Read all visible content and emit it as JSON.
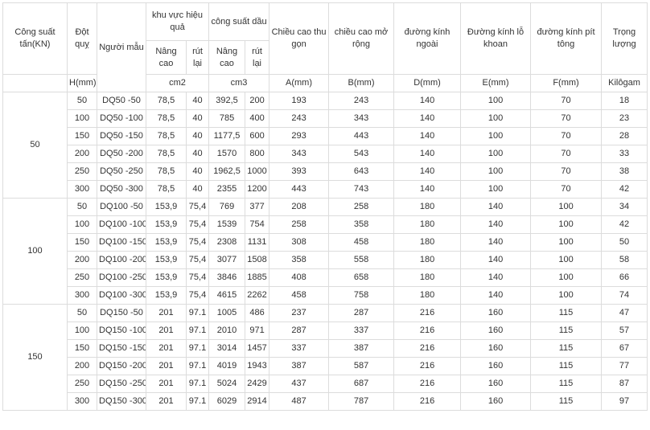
{
  "headers": {
    "capacity": "Công suất tấn(KN)",
    "stroke": "Đột quỵ",
    "model": "Người mẫu",
    "effective_area": "khu vực hiệu quả",
    "oil_capacity": "công suất dầu",
    "closed_height": "Chiều cao thu gọn",
    "extended_height": "chiều cao mở rộng",
    "outer_diameter": "đường kính ngoài",
    "bore_diameter": "Đường kính lỗ khoan",
    "piston_diameter": "đường kính pít tông",
    "weight": "Trọng lượng",
    "area_lift": "Nâng cao",
    "area_retract": "rút lại",
    "oil_lift": "Nâng cao",
    "oil_retract": "rút lại"
  },
  "units": {
    "stroke": "H(mm)",
    "area": "cm2",
    "oil": "cm3",
    "closed": "A(mm)",
    "extended": "B(mm)",
    "outer": "D(mm)",
    "bore": "E(mm)",
    "piston": "F(mm)",
    "weight": "Kilôgam"
  },
  "groups": [
    {
      "capacity": "50",
      "rows": [
        [
          "50",
          "DQ50 -50",
          "78,5",
          "40",
          "392,5",
          "200",
          "193",
          "243",
          "140",
          "100",
          "70",
          "18"
        ],
        [
          "100",
          "DQ50 -100",
          "78,5",
          "40",
          "785",
          "400",
          "243",
          "343",
          "140",
          "100",
          "70",
          "23"
        ],
        [
          "150",
          "DQ50 -150",
          "78,5",
          "40",
          "1177,5",
          "600",
          "293",
          "443",
          "140",
          "100",
          "70",
          "28"
        ],
        [
          "200",
          "DQ50 -200",
          "78,5",
          "40",
          "1570",
          "800",
          "343",
          "543",
          "140",
          "100",
          "70",
          "33"
        ],
        [
          "250",
          "DQ50 -250",
          "78,5",
          "40",
          "1962,5",
          "1000",
          "393",
          "643",
          "140",
          "100",
          "70",
          "38"
        ],
        [
          "300",
          "DQ50 -300",
          "78,5",
          "40",
          "2355",
          "1200",
          "443",
          "743",
          "140",
          "100",
          "70",
          "42"
        ]
      ]
    },
    {
      "capacity": "100",
      "rows": [
        [
          "50",
          "DQ100 -50",
          "153,9",
          "75,4",
          "769",
          "377",
          "208",
          "258",
          "180",
          "140",
          "100",
          "34"
        ],
        [
          "100",
          "DQ100 -100",
          "153,9",
          "75,4",
          "1539",
          "754",
          "258",
          "358",
          "180",
          "140",
          "100",
          "42"
        ],
        [
          "150",
          "DQ100 -150",
          "153,9",
          "75,4",
          "2308",
          "1131",
          "308",
          "458",
          "180",
          "140",
          "100",
          "50"
        ],
        [
          "200",
          "DQ100 -200",
          "153,9",
          "75,4",
          "3077",
          "1508",
          "358",
          "558",
          "180",
          "140",
          "100",
          "58"
        ],
        [
          "250",
          "DQ100 -250",
          "153,9",
          "75,4",
          "3846",
          "1885",
          "408",
          "658",
          "180",
          "140",
          "100",
          "66"
        ],
        [
          "300",
          "DQ100 -300",
          "153,9",
          "75,4",
          "4615",
          "2262",
          "458",
          "758",
          "180",
          "140",
          "100",
          "74"
        ]
      ]
    },
    {
      "capacity": "150",
      "rows": [
        [
          "50",
          "DQ150 -50",
          "201",
          "97.1",
          "1005",
          "486",
          "237",
          "287",
          "216",
          "160",
          "115",
          "47"
        ],
        [
          "100",
          "DQ150 -100",
          "201",
          "97.1",
          "2010",
          "971",
          "287",
          "337",
          "216",
          "160",
          "115",
          "57"
        ],
        [
          "150",
          "DQ150 -150",
          "201",
          "97.1",
          "3014",
          "1457",
          "337",
          "387",
          "216",
          "160",
          "115",
          "67"
        ],
        [
          "200",
          "DQ150 -200",
          "201",
          "97.1",
          "4019",
          "1943",
          "387",
          "587",
          "216",
          "160",
          "115",
          "77"
        ],
        [
          "250",
          "DQ150 -250",
          "201",
          "97.1",
          "5024",
          "2429",
          "437",
          "687",
          "216",
          "160",
          "115",
          "87"
        ],
        [
          "300",
          "DQ150 -300",
          "201",
          "97.1",
          "6029",
          "2914",
          "487",
          "787",
          "216",
          "160",
          "115",
          "97"
        ]
      ]
    }
  ]
}
